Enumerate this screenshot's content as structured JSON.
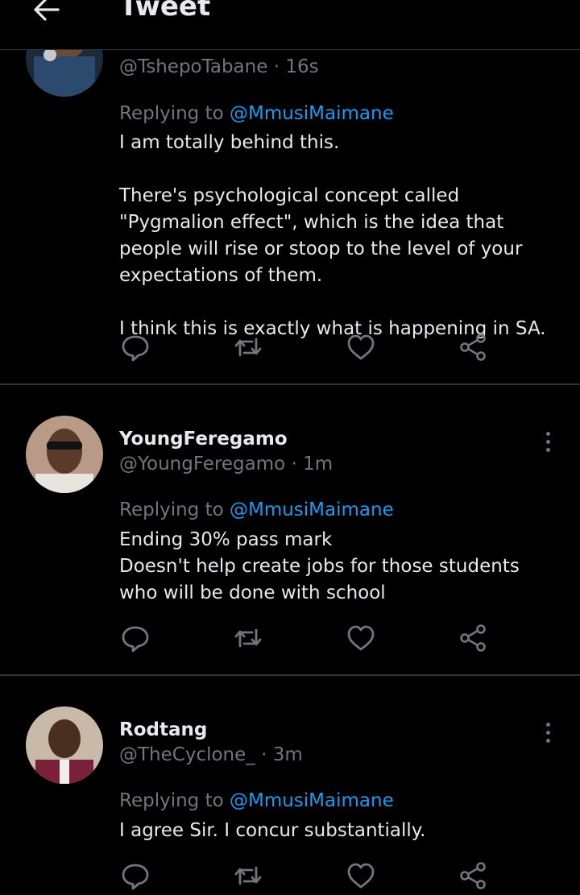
{
  "header": {
    "title": "Tweet",
    "back_icon": "arrow-left-icon"
  },
  "colors": {
    "background": "#000000",
    "text": "#e7e9ea",
    "muted": "#71767b",
    "link": "#1d9bf0",
    "divider": "#2f3336"
  },
  "tweets": [
    {
      "name": "",
      "handle": "@TshepoTabane",
      "time": "16s",
      "reply_prefix": "Replying to",
      "reply_to": "@MmusiMaimane",
      "lines": [
        "I am totally behind this.",
        "There's psychological concept called \"Pygmalion effect\", which is the idea that people will rise or stoop to the level of your expectations of them.",
        "I think this is exactly what is happening in SA."
      ]
    },
    {
      "name": "YoungFeregamo",
      "handle": "@YoungFeregamo",
      "time": "1m",
      "reply_prefix": "Replying to",
      "reply_to": "@MmusiMaimane",
      "lines": [
        "Ending 30% pass mark",
        "Doesn't help create jobs for those students who will be done with school"
      ]
    },
    {
      "name": "Rodtang",
      "handle": "@TheCyclone_",
      "time": "3m",
      "reply_prefix": "Replying to",
      "reply_to": "@MmusiMaimane",
      "lines": [
        "I agree Sir. I concur substantially."
      ]
    }
  ],
  "actions": [
    "reply-icon",
    "retweet-icon",
    "like-icon",
    "share-icon"
  ]
}
